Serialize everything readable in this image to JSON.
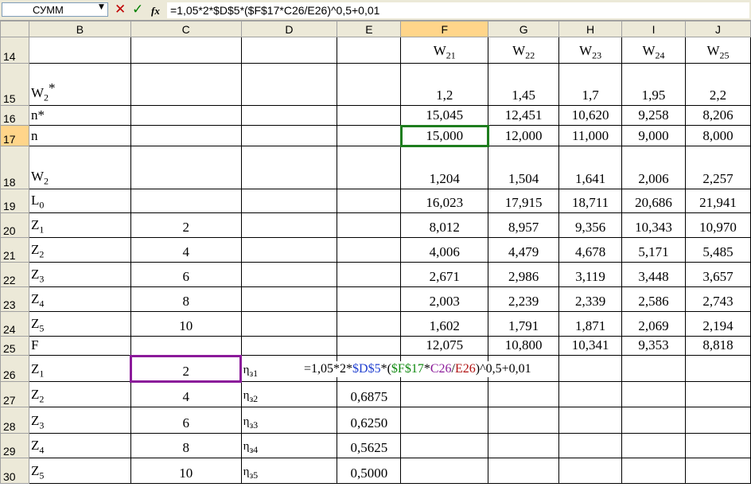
{
  "formula_bar": {
    "name_box": "СУММ",
    "fx_label": "fx",
    "formula": "=1,05*2*$D$5*($F$17*C26/E26)^0,5+0,01"
  },
  "columns": [
    "B",
    "C",
    "D",
    "E",
    "F",
    "G",
    "H",
    "I",
    "J"
  ],
  "rows": [
    {
      "num": "14",
      "b": "",
      "bsub": "",
      "bsup": "",
      "c": "",
      "d": "",
      "dsub": "",
      "e": "",
      "f": "W",
      "fsub": "21",
      "g": "W",
      "gsub": "22",
      "h": "W",
      "hsub": "23",
      "i": "W",
      "isub": "24",
      "j": "W",
      "jsub": "25"
    },
    {
      "num": "15",
      "b": "W",
      "bsub": "2",
      "bsup": "*",
      "c": "",
      "d": "",
      "dsub": "",
      "e": "",
      "f": "1,2",
      "g": "1,45",
      "h": "1,7",
      "i": "1,95",
      "j": "2,2"
    },
    {
      "num": "16",
      "b": "n*",
      "bsub": "",
      "bsup": "",
      "c": "",
      "d": "",
      "dsub": "",
      "e": "",
      "f": "15,045",
      "g": "12,451",
      "h": "10,620",
      "i": "9,258",
      "j": "8,206"
    },
    {
      "num": "17",
      "b": "n",
      "bsub": "",
      "bsup": "",
      "c": "",
      "d": "",
      "dsub": "",
      "e": "",
      "f": "15,000",
      "g": "12,000",
      "h": "11,000",
      "i": "9,000",
      "j": "8,000"
    },
    {
      "num": "18",
      "b": "W",
      "bsub": "2",
      "bsup": "",
      "c": "",
      "d": "",
      "dsub": "",
      "e": "",
      "f": "1,204",
      "g": "1,504",
      "h": "1,641",
      "i": "2,006",
      "j": "2,257"
    },
    {
      "num": "19",
      "b": "L",
      "bsub": "0",
      "bsup": "",
      "c": "",
      "d": "",
      "dsub": "",
      "e": "",
      "f": "16,023",
      "g": "17,915",
      "h": "18,711",
      "i": "20,686",
      "j": "21,941"
    },
    {
      "num": "20",
      "b": "Z",
      "bsub": "1",
      "bsup": "",
      "c": "2",
      "d": "",
      "dsub": "",
      "e": "",
      "f": "8,012",
      "g": "8,957",
      "h": "9,356",
      "i": "10,343",
      "j": "10,970"
    },
    {
      "num": "21",
      "b": "Z",
      "bsub": "2",
      "bsup": "",
      "c": "4",
      "d": "",
      "dsub": "",
      "e": "",
      "f": "4,006",
      "g": "4,479",
      "h": "4,678",
      "i": "5,171",
      "j": "5,485"
    },
    {
      "num": "22",
      "b": "Z",
      "bsub": "3",
      "bsup": "",
      "c": "6",
      "d": "",
      "dsub": "",
      "e": "",
      "f": "2,671",
      "g": "2,986",
      "h": "3,119",
      "i": "3,448",
      "j": "3,657"
    },
    {
      "num": "23",
      "b": "Z",
      "bsub": "4",
      "bsup": "",
      "c": "8",
      "d": "",
      "dsub": "",
      "e": "",
      "f": "2,003",
      "g": "2,239",
      "h": "2,339",
      "i": "2,586",
      "j": "2,743"
    },
    {
      "num": "24",
      "b": "Z",
      "bsub": "5",
      "bsup": "",
      "c": "10",
      "d": "",
      "dsub": "",
      "e": "",
      "f": "1,602",
      "g": "1,791",
      "h": "1,871",
      "i": "2,069",
      "j": "2,194"
    },
    {
      "num": "25",
      "b": "F",
      "bsub": "",
      "bsup": "",
      "c": "",
      "d": "",
      "dsub": "",
      "e": "",
      "f": "12,075",
      "g": "10,800",
      "h": "10,341",
      "i": "9,353",
      "j": "8,818"
    },
    {
      "num": "26",
      "b": "Z",
      "bsub": "1",
      "bsup": "",
      "c": "2",
      "d": "η",
      "dsub": "з1",
      "e": "",
      "f": "",
      "g": "",
      "h": "",
      "i": "",
      "j": ""
    },
    {
      "num": "27",
      "b": "Z",
      "bsub": "2",
      "bsup": "",
      "c": "4",
      "d": "η",
      "dsub": "з2",
      "e": "0,6875",
      "f": "",
      "g": "",
      "h": "",
      "i": "",
      "j": ""
    },
    {
      "num": "28",
      "b": "Z",
      "bsub": "3",
      "bsup": "",
      "c": "6",
      "d": "η",
      "dsub": "з3",
      "e": "0,6250",
      "f": "",
      "g": "",
      "h": "",
      "i": "",
      "j": ""
    },
    {
      "num": "29",
      "b": "Z",
      "bsub": "4",
      "bsup": "",
      "c": "8",
      "d": "η",
      "dsub": "з4",
      "e": "0,5625",
      "f": "",
      "g": "",
      "h": "",
      "i": "",
      "j": ""
    },
    {
      "num": "30",
      "b": "Z",
      "bsub": "5",
      "bsup": "",
      "c": "10",
      "d": "η",
      "dsub": "з5",
      "e": "0,5000",
      "f": "",
      "g": "",
      "h": "",
      "i": "",
      "j": ""
    }
  ],
  "in_cell_edit": {
    "parts": [
      "=1,05*2*",
      "$D$5",
      "*(",
      "$F$17",
      "*",
      "C26",
      "/",
      "E26",
      ")^0,5+0,01"
    ]
  },
  "colors": {
    "ref_d5": "#1f3fd0",
    "ref_f17": "#118a11",
    "ref_c26": "#8b1a9a",
    "ref_e26": "#b01010"
  }
}
